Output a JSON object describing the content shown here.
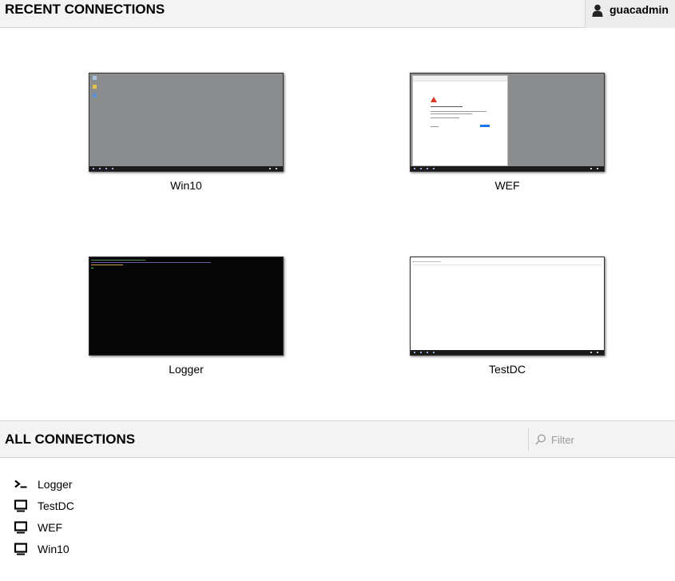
{
  "header": {
    "title": "RECENT CONNECTIONS",
    "username": "guacadmin",
    "user_icon": "user-icon"
  },
  "recent": [
    {
      "name": "Win10",
      "thumbnail": "windows-desktop"
    },
    {
      "name": "WEF",
      "thumbnail": "windows-desktop-browser"
    },
    {
      "name": "Logger",
      "thumbnail": "terminal"
    },
    {
      "name": "TestDC",
      "thumbnail": "windows-desktop-white"
    }
  ],
  "all_connections": {
    "title": "ALL CONNECTIONS",
    "filter_placeholder": "Filter",
    "filter_icon": "search-icon",
    "items": [
      {
        "name": "Logger",
        "icon": "terminal-icon"
      },
      {
        "name": "TestDC",
        "icon": "desktop-icon"
      },
      {
        "name": "WEF",
        "icon": "desktop-icon"
      },
      {
        "name": "Win10",
        "icon": "desktop-icon"
      }
    ]
  },
  "colors": {
    "bar_background": "#f3f3f3",
    "border": "#d6d6d6",
    "desktop_gray": "#8b8c8e",
    "terminal_black": "#050505"
  }
}
